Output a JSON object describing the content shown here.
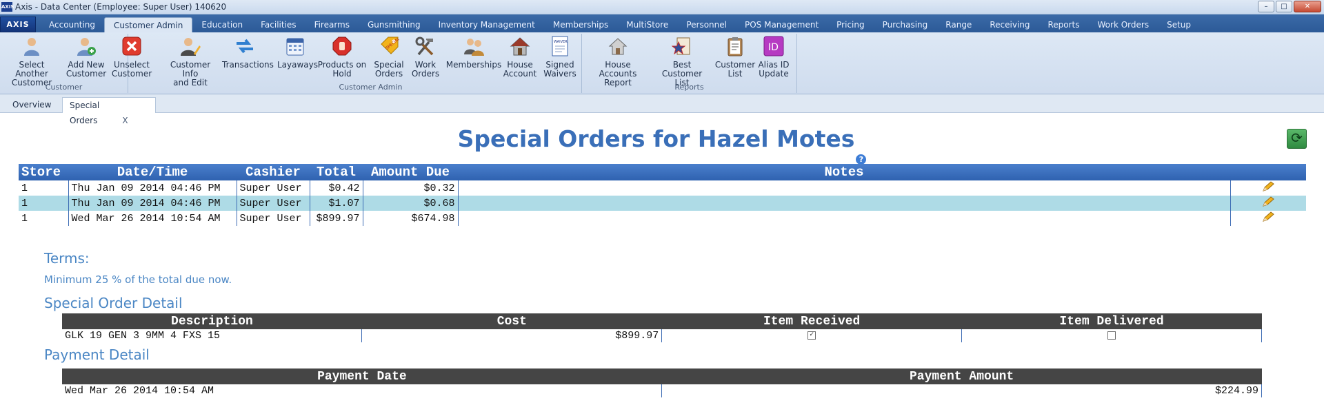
{
  "window": {
    "title": "Axis - Data Center  (Employee: Super User) 140620",
    "app_logo": "AXIS"
  },
  "menu": {
    "logo": "AXIS",
    "tabs": [
      "Accounting",
      "Customer Admin",
      "Education",
      "Facilities",
      "Firearms",
      "Gunsmithing",
      "Inventory Management",
      "Memberships",
      "MultiStore",
      "Personnel",
      "POS Management",
      "Pricing",
      "Purchasing",
      "Range",
      "Receiving",
      "Reports",
      "Work Orders",
      "Setup"
    ],
    "active_tab": "Customer Admin"
  },
  "ribbon": {
    "groups": {
      "customer": {
        "label": "Customer",
        "buttons": [
          {
            "label": "Select Another\nCustomer",
            "icon": "person-icon"
          },
          {
            "label": "Add New\nCustomer",
            "icon": "person-add-icon"
          },
          {
            "label": "Unselect\nCustomer",
            "icon": "red-x-icon"
          }
        ]
      },
      "customer_admin": {
        "label": "Customer Admin",
        "buttons": [
          {
            "label": "Customer Info\nand Edit",
            "icon": "person-edit-icon"
          },
          {
            "label": "Transactions",
            "icon": "arrows-icon"
          },
          {
            "label": "Layaways",
            "icon": "calendar-icon"
          },
          {
            "label": "Products on\nHold",
            "icon": "stop-hand-icon"
          },
          {
            "label": "Special\nOrders",
            "icon": "special-tag-icon"
          },
          {
            "label": "Work\nOrders",
            "icon": "tools-icon"
          },
          {
            "label": "Memberships",
            "icon": "people-icon"
          },
          {
            "label": "House\nAccount",
            "icon": "house-icon"
          },
          {
            "label": "Signed\nWaivers",
            "icon": "waiver-doc-icon"
          }
        ]
      },
      "reports": {
        "label": "Reports",
        "buttons": [
          {
            "label": "House Accounts\nReport",
            "icon": "house-report-icon"
          },
          {
            "label": "Best Customer\nList",
            "icon": "star-list-icon"
          },
          {
            "label": "Customer\nList",
            "icon": "clipboard-icon"
          },
          {
            "label": "Alias ID\nUpdate",
            "icon": "id-badge-icon"
          }
        ]
      }
    }
  },
  "doc_tabs": {
    "overview": "Overview",
    "special_orders": "Special Orders",
    "close": "X"
  },
  "page": {
    "title": "Special Orders for Hazel Motes",
    "help": "?",
    "refresh_icon": "refresh-icon"
  },
  "orders": {
    "headers": {
      "store": "Store",
      "datetime": "Date/Time",
      "cashier": "Cashier",
      "total": "Total",
      "amount_due": "Amount Due",
      "notes": "Notes"
    },
    "rows": [
      {
        "store": "1",
        "datetime": "Thu Jan 09 2014 04:46 PM",
        "cashier": "Super User",
        "total": "$0.42",
        "amount_due": "$0.32",
        "notes": ""
      },
      {
        "store": "1",
        "datetime": "Thu Jan 09 2014 04:46 PM",
        "cashier": "Super User",
        "total": "$1.07",
        "amount_due": "$0.68",
        "notes": ""
      },
      {
        "store": "1",
        "datetime": "Wed Mar 26 2014 10:54 AM",
        "cashier": "Super User",
        "total": "$899.97",
        "amount_due": "$674.98",
        "notes": ""
      }
    ],
    "selected_row": 1
  },
  "terms": {
    "heading": "Terms:",
    "text": "Minimum 25 % of the total due now."
  },
  "order_detail": {
    "heading": "Special Order Detail",
    "headers": {
      "description": "Description",
      "cost": "Cost",
      "received": "Item Received",
      "delivered": "Item Delivered"
    },
    "rows": [
      {
        "description": "GLK 19 GEN 3 9MM 4 FXS 15",
        "cost": "$899.97",
        "received": true,
        "delivered": false
      }
    ]
  },
  "payment_detail": {
    "heading": "Payment Detail",
    "headers": {
      "date": "Payment Date",
      "amount": "Payment Amount"
    },
    "rows": [
      {
        "date": "Wed Mar 26 2014 10:54 AM",
        "amount": "$224.99"
      }
    ]
  },
  "colors": {
    "accent": "#3a6fb8",
    "section_heading": "#4a86c4",
    "table_header_blue": "#3f73c0",
    "table_header_dark": "#454545",
    "selected_row": "#aedbe6"
  }
}
